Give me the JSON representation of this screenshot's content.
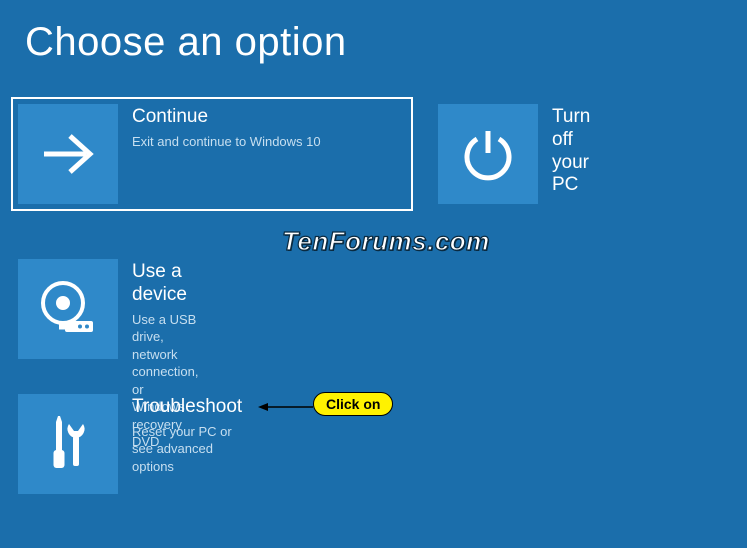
{
  "title": "Choose an option",
  "tiles": {
    "continue": {
      "title": "Continue",
      "desc": "Exit and continue to Windows 10"
    },
    "turnoff": {
      "title": "Turn off your PC",
      "desc": ""
    },
    "device": {
      "title": "Use a device",
      "desc": "Use a USB drive, network connection, or Windows recovery DVD"
    },
    "troubleshoot": {
      "title": "Troubleshoot",
      "desc": "Reset your PC or see advanced options"
    }
  },
  "watermark": "TenForums.com",
  "callout": "Click on"
}
